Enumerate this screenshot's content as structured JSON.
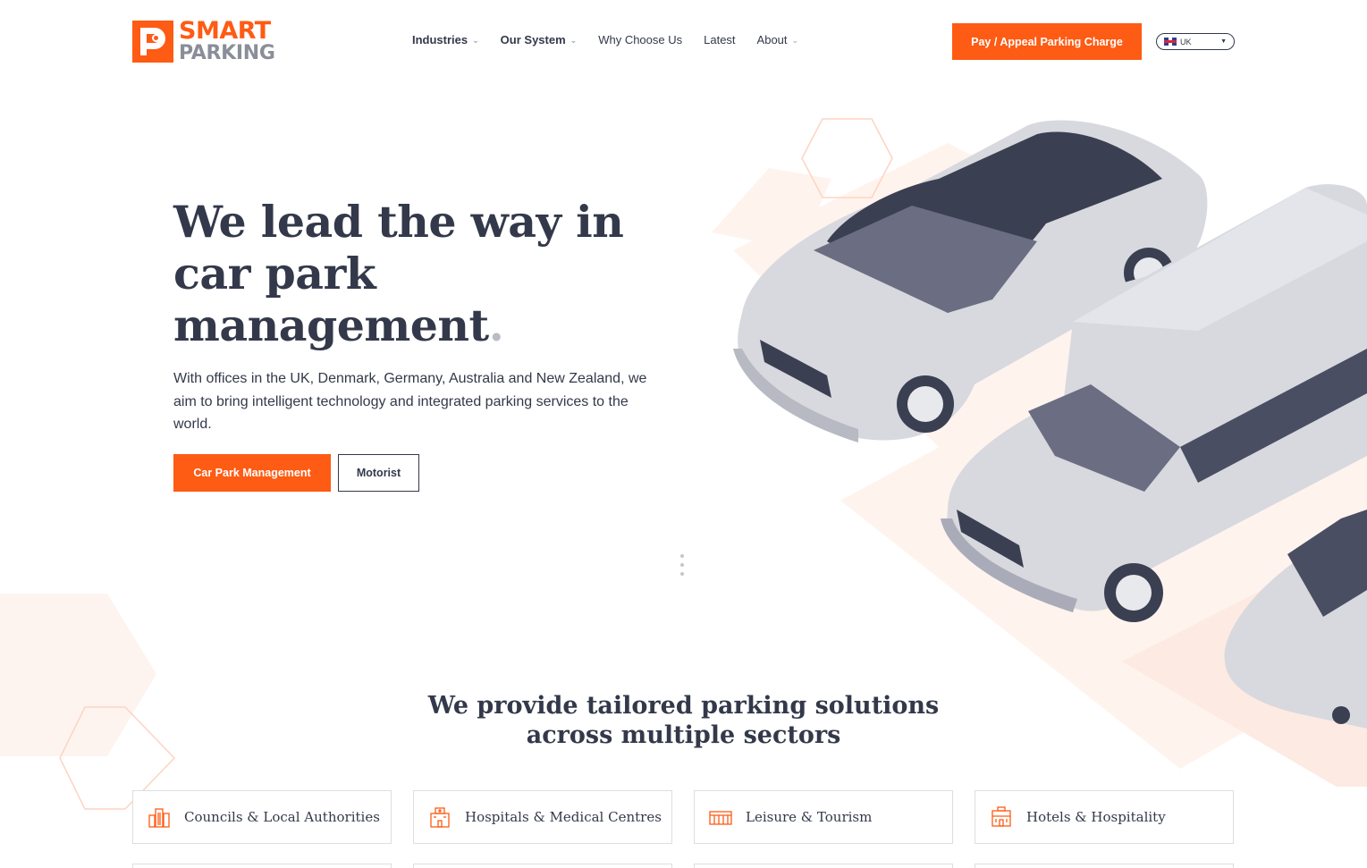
{
  "brand": {
    "line1": "SMART",
    "line2": "PARKING",
    "accent": "#fe5b14",
    "text_color": "#33394a"
  },
  "nav": {
    "items": [
      {
        "label": "Industries",
        "bold": true,
        "dropdown": true
      },
      {
        "label": "Our System",
        "bold": true,
        "dropdown": true
      },
      {
        "label": "Why Choose Us",
        "bold": false,
        "dropdown": false
      },
      {
        "label": "Latest",
        "bold": false,
        "dropdown": false
      },
      {
        "label": "About",
        "bold": false,
        "dropdown": true
      }
    ]
  },
  "header": {
    "pay_label": "Pay / Appeal Parking Charge",
    "locale": "UK"
  },
  "hero": {
    "title_lines": [
      "We lead the way in",
      "car park",
      "management"
    ],
    "title_dot": ".",
    "subtitle": "With offices in the UK, Denmark, Germany, Australia and New Zealand, we aim to bring intelligent technology and integrated parking services to the world.",
    "btn_primary": "Car Park Management",
    "btn_secondary": "Motorist"
  },
  "sectors": {
    "title_line1": "We provide tailored parking solutions",
    "title_line2": "across multiple sectors",
    "cards": [
      {
        "label": "Councils & Local Authorities",
        "icon": "city-buildings-icon"
      },
      {
        "label": "Hospitals & Medical Centres",
        "icon": "hospital-icon"
      },
      {
        "label": "Leisure & Tourism",
        "icon": "stadium-icon"
      },
      {
        "label": "Hotels & Hospitality",
        "icon": "hotel-icon"
      }
    ]
  }
}
